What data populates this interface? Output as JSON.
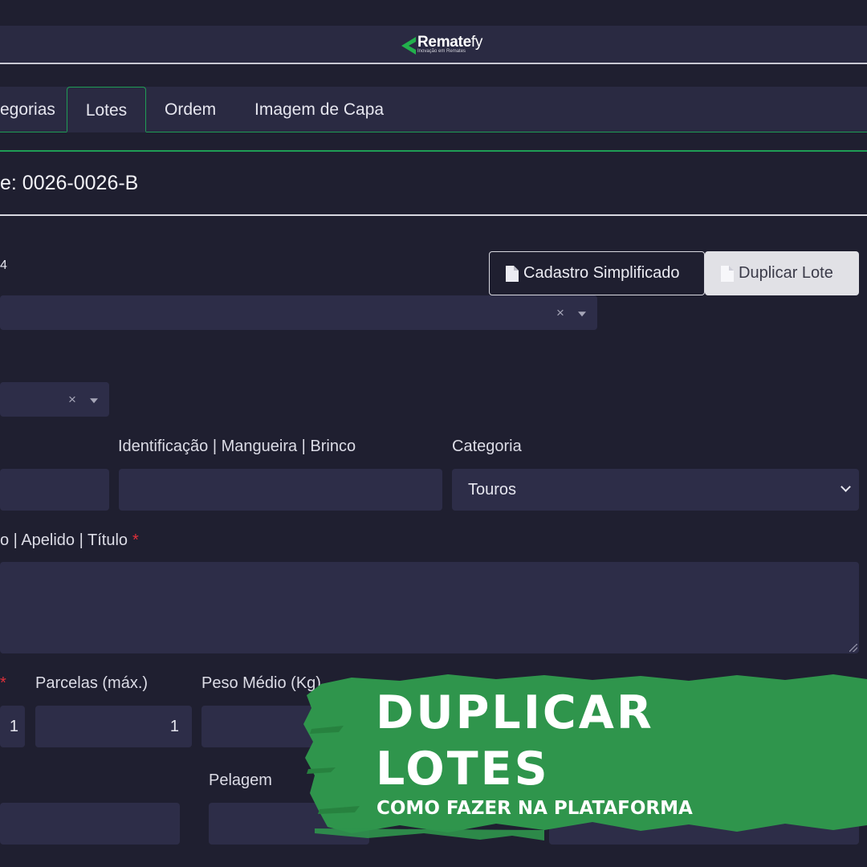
{
  "header": {
    "brand_bold": "Remate",
    "brand_light": "fy",
    "tagline": "Inovação em Remates"
  },
  "tabs": [
    {
      "label": "egorias",
      "active": false
    },
    {
      "label": "Lotes",
      "active": true
    },
    {
      "label": "Ordem",
      "active": false
    },
    {
      "label": "Imagem de Capa",
      "active": false
    }
  ],
  "lote": {
    "title": "e: 0026-0026-B"
  },
  "actions": {
    "simplified_label": "Cadastro Simplificado",
    "duplicate_label": "Duplicar Lote"
  },
  "fields": {
    "identification_label": "Identificação | Mangueira | Brinco",
    "category_label": "Categoria",
    "category_value": "Touros",
    "name_label": "o | Apelido | Título",
    "parcelas_label": "Parcelas (máx.)",
    "parcelas_value": "1",
    "left_value": "1",
    "peso_label": "Peso Médio (Kg)",
    "pelagem_label": "Pelagem",
    "clear_symbol": "×",
    "required_mark": "*"
  },
  "banner": {
    "line1": "DUPLICAR",
    "line2": "LOTES",
    "subtitle": "COMO FAZER NA PLATAFORMA"
  },
  "colors": {
    "background": "#1f1f30",
    "panel": "#2a2a42",
    "input": "#2d2d48",
    "accent_green": "#1f9d55",
    "banner_green": "#2f954c",
    "required": "#e0303a"
  },
  "icons": [
    "logo-arrow-icon",
    "document-icon",
    "clear-icon",
    "caret-down-icon",
    "chevron-down-icon",
    "resize-handle-icon"
  ]
}
